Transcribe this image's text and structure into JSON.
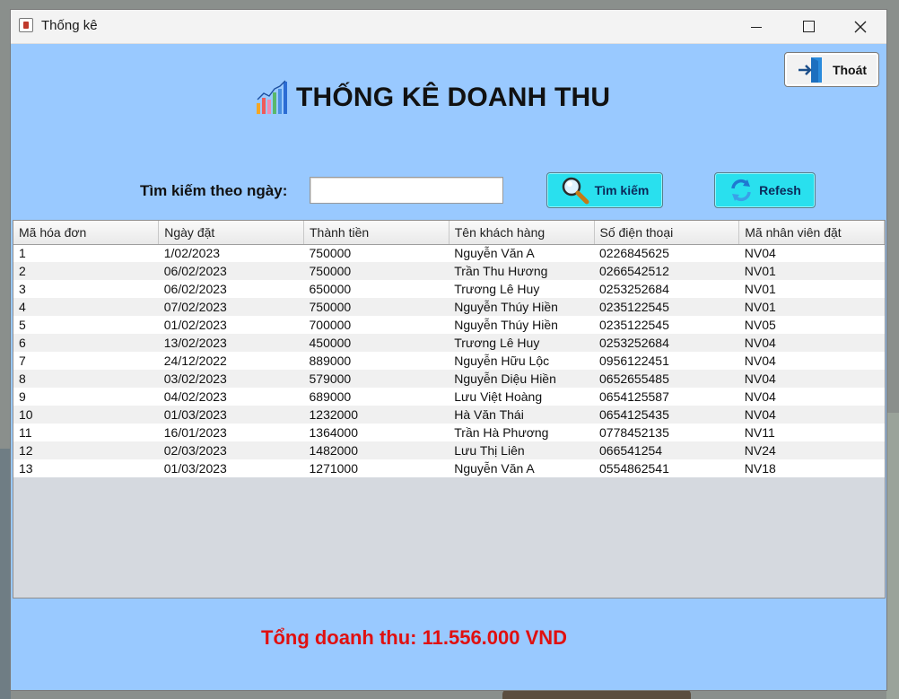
{
  "window": {
    "title": "Thống kê",
    "controls": {
      "minimize": "—",
      "maximize": "☐",
      "close": "✕"
    }
  },
  "header": {
    "title": "THỐNG KÊ DOANH THU",
    "icon": "bar-chart-icon"
  },
  "exit_button": {
    "label": "Thoát",
    "icon": "exit-door-icon"
  },
  "search": {
    "label": "Tìm kiếm theo ngày:",
    "value": "",
    "placeholder": "",
    "button_label": "Tìm kiếm",
    "button_icon": "magnifier-icon"
  },
  "refresh_button": {
    "label": "Refesh",
    "icon": "refresh-icon"
  },
  "table": {
    "columns": [
      "Mã hóa đơn",
      "Ngày đặt",
      "Thành tiền",
      "Tên khách hàng",
      "Số điện thoại",
      "Mã nhân viên đặt"
    ],
    "rows": [
      [
        "1",
        "1/02/2023",
        "750000",
        "Nguyễn Văn A",
        "0226845625",
        "NV04"
      ],
      [
        "2",
        "06/02/2023",
        "750000",
        "Trần Thu Hương",
        "0266542512",
        "NV01"
      ],
      [
        "3",
        "06/02/2023",
        "650000",
        "Trương Lê Huy",
        "0253252684",
        "NV01"
      ],
      [
        "4",
        "07/02/2023",
        "750000",
        "Nguyễn Thúy Hiền",
        "0235122545",
        "NV01"
      ],
      [
        "5",
        "01/02/2023",
        "700000",
        "Nguyễn Thúy Hiền",
        "0235122545",
        "NV05"
      ],
      [
        "6",
        "13/02/2023",
        "450000",
        "Trương Lê Huy",
        "0253252684",
        "NV04"
      ],
      [
        "7",
        "24/12/2022",
        "889000",
        "Nguyễn Hữu Lộc",
        "0956122451",
        "NV04"
      ],
      [
        "8",
        "03/02/2023",
        "579000",
        "Nguyễn Diệu Hiền",
        "0652655485",
        "NV04"
      ],
      [
        "9",
        "04/02/2023",
        "689000",
        "Lưu Việt Hoàng",
        "0654125587",
        "NV04"
      ],
      [
        "10",
        "01/03/2023",
        "1232000",
        "Hà Văn Thái",
        "0654125435",
        "NV04"
      ],
      [
        "11",
        "16/01/2023",
        "1364000",
        "Trần Hà Phương",
        "0778452135",
        "NV11"
      ],
      [
        "12",
        "02/03/2023",
        "1482000",
        "Lưu Thị Liên",
        "066541254",
        "NV24"
      ],
      [
        "13",
        "01/03/2023",
        "1271000",
        "Nguyễn Văn A",
        "0554862541",
        "NV18"
      ]
    ]
  },
  "summary": {
    "total_text": "Tổng doanh thu: 11.556.000 VND"
  },
  "colors": {
    "window_background": "#99c9ff",
    "action_button": "#29e0ee",
    "total_text": "#e01010"
  }
}
